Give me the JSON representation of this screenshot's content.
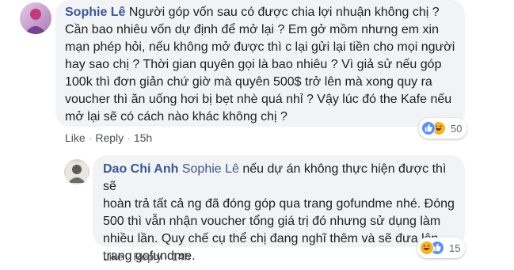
{
  "comments": [
    {
      "author": "Sophie Lê",
      "lines": [
        "Người góp vốn sau có được chia lợi nhuận không chị ?",
        "Cần bao nhiêu vốn dự định để mở lại ? Em gở mồm nhưng em xin",
        "mạn phép hỏi, nếu không mở được thì c lại gửi lại tiền cho mọi người",
        "hay sao chị ? Thời gian quyên gọi là bao nhiêu ? Vì giả sử nếu góp",
        "100k thì đơn giản chứ giờ mà quyên 500$ trở lên mà xong quy ra",
        "voucher thì ăn uống hơi bị bẹt nhè quá nhỉ ? Vậy lúc đó the Kafe nếu",
        "mở lại sẽ có cách nào khác không chị ?"
      ],
      "reaction_count": "50",
      "actions": {
        "like": "Like",
        "reply": "Reply",
        "time": "15h"
      }
    },
    {
      "author": "Dao Chi Anh",
      "mention": "Sophie Lê",
      "lines": [
        "nếu dự án không thực hiện được thì sẽ",
        "hoàn trả tất cả ng đã đóng góp qua trang gofundme nhé. Đóng",
        "500 thì vẫn nhận voucher tổng giá trị đó nhưng sử dụng làm",
        "nhiều lần. Quy chế cụ thể chị đang nghĩ thêm và sẽ đưa lên",
        "trang gofundme."
      ],
      "reaction_count": "15",
      "actions": {
        "like": "Like",
        "reply": "Reply",
        "time": "14h"
      }
    }
  ],
  "icons": {
    "reactions": [
      "like-icon",
      "haha-icon"
    ]
  },
  "colors": {
    "author": "#385898",
    "bubble": "#f2f3f5",
    "text": "#1c1e21",
    "meta": "#606770"
  }
}
